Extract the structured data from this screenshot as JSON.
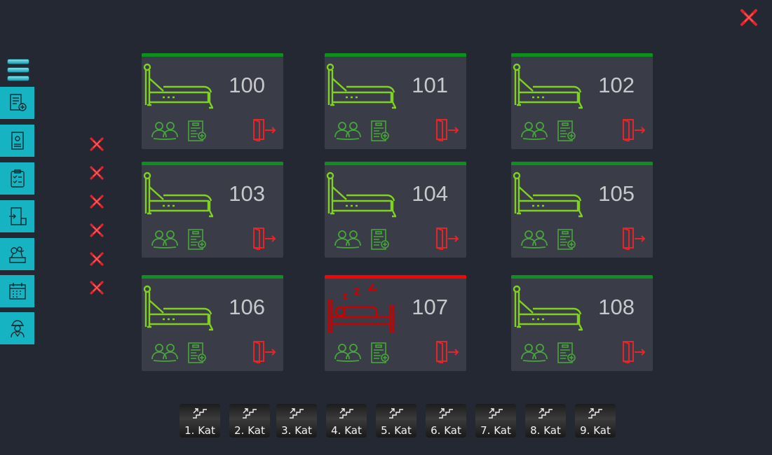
{
  "rooms": [
    {
      "number": "100",
      "status": "available"
    },
    {
      "number": "101",
      "status": "available"
    },
    {
      "number": "102",
      "status": "available"
    },
    {
      "number": "103",
      "status": "available"
    },
    {
      "number": "104",
      "status": "available"
    },
    {
      "number": "105",
      "status": "available"
    },
    {
      "number": "106",
      "status": "available"
    },
    {
      "number": "107",
      "status": "occupied"
    },
    {
      "number": "108",
      "status": "available"
    }
  ],
  "floors": [
    "1. Kat",
    "2. Kat",
    "3. Kat",
    "4. Kat",
    "5. Kat",
    "6. Kat",
    "7. Kat",
    "8. Kat",
    "9. Kat"
  ],
  "sidebar": {
    "items": [
      {
        "icon": "add-document-icon"
      },
      {
        "icon": "id-card-icon"
      },
      {
        "icon": "clipboard-checklist-icon"
      },
      {
        "icon": "door-exit-icon"
      },
      {
        "icon": "cleaning-supplies-icon"
      },
      {
        "icon": "calendar-icon"
      },
      {
        "icon": "staff-worker-icon"
      }
    ]
  },
  "colors": {
    "background": "#232833",
    "card": "#3a3d47",
    "available": "#0f8f1f",
    "occupied": "#ff0000",
    "sidebar_button": "#16b3c3",
    "bed_green": "#7fd320",
    "bed_red": "#c80000",
    "close_red": "#e0242b"
  }
}
